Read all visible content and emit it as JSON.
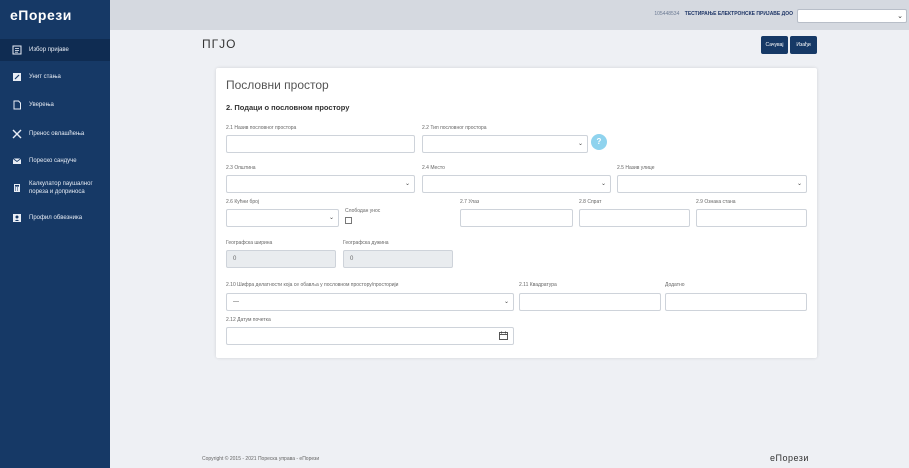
{
  "app": {
    "brand": "еПорези"
  },
  "sidebar": {
    "items": [
      {
        "label": "Избор пријаве",
        "icon": "form-list-icon"
      },
      {
        "label": "Унит стања",
        "icon": "pencil-icon"
      },
      {
        "label": "Уверења",
        "icon": "document-icon"
      },
      {
        "label": "Пренос овлашћења",
        "icon": "transfer-icon"
      },
      {
        "label": "Пореско сандуче",
        "icon": "envelope-icon"
      },
      {
        "label": "Калкулатор паушалног пореза и доприноса",
        "icon": "calculator-icon"
      },
      {
        "label": "Профил обвезника",
        "icon": "profile-icon"
      }
    ]
  },
  "topbar": {
    "company_pib": "105448534",
    "company_name": "ТЕСТИРАЊЕ ЕЛЕКТРОНСКЕ ПРИЈАВЕ ДОО",
    "company_select_value": ""
  },
  "header": {
    "title": "ПГЈО",
    "save_label": "Сачувај",
    "exit_label": "Изађи"
  },
  "card": {
    "title": "Пословни простор",
    "section": "2. Подаци о пословном простору",
    "fields": {
      "name": {
        "label": "2.1 Назив пословног простора",
        "value": ""
      },
      "type": {
        "label": "2.2 Тип пословног простора",
        "value": ""
      },
      "municipality": {
        "label": "2.3 Општина",
        "value": ""
      },
      "place": {
        "label": "2.4 Место",
        "value": ""
      },
      "street": {
        "label": "2.5 Назив улице",
        "value": ""
      },
      "house_no": {
        "label": "2.6 Кућни број",
        "value": ""
      },
      "free_entry": {
        "label": "Слободан унос"
      },
      "entrance": {
        "label": "2.7 Улаз",
        "value": ""
      },
      "floor": {
        "label": "2.8 Спрат",
        "value": ""
      },
      "apartment": {
        "label": "2.9 Ознака стана",
        "value": ""
      },
      "latitude": {
        "label": "Географска ширина",
        "value": "0"
      },
      "longitude": {
        "label": "Географска дужина",
        "value": "0"
      },
      "activity": {
        "label": "2.10 Шифра делатности која се обавља у пословном простору/просторији",
        "value": "---"
      },
      "area": {
        "label": "2.11 Квадратура",
        "value": ""
      },
      "additional": {
        "label": "Додатно",
        "value": ""
      },
      "start_date": {
        "label": "2.12 Датум почетка",
        "value": ""
      }
    }
  },
  "footer": {
    "copyright": "Copyright © 2015 - 2021 Пореска управа - еПорези",
    "logo": "еПорези"
  },
  "colors": {
    "sidebar": "#163966",
    "accent": "#163966",
    "help": "#8fd3ee"
  }
}
